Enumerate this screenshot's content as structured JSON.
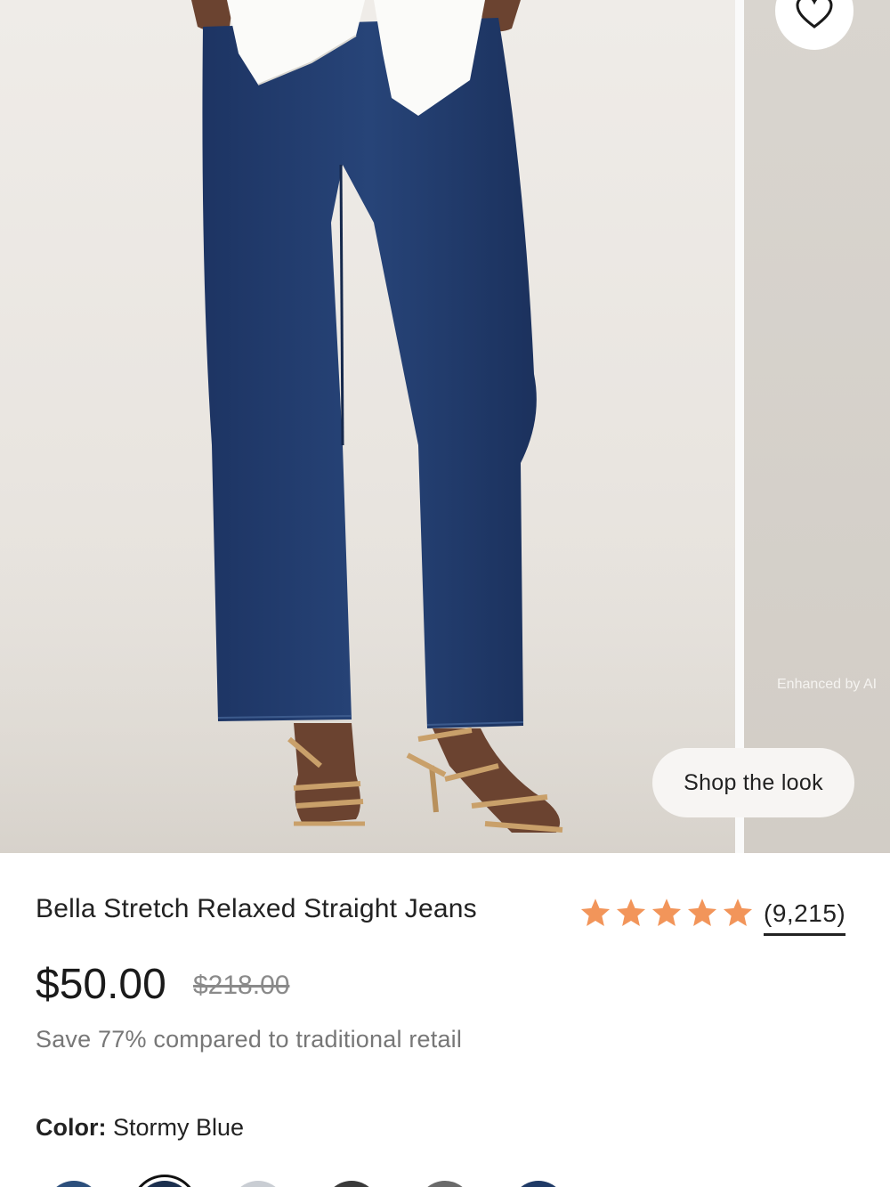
{
  "gallery": {
    "enhanced_label": "Enhanced by AI",
    "shop_look_label": "Shop the look",
    "favorite_icon": "heart-icon"
  },
  "product": {
    "title": "Bella Stretch Relaxed Straight Jeans",
    "rating_value": 5,
    "rating_max": 5,
    "review_count": "(9,215)",
    "price": "$50.00",
    "original_price": "$218.00",
    "savings_text": "Save 77% compared to traditional retail"
  },
  "color": {
    "label": "Color:",
    "selected": "Stormy Blue",
    "swatches": [
      "#2c4f7c",
      "#1b2f4e",
      "#c9cdd3",
      "#3a3a3a",
      "#6a6a6a",
      "#1f3a66"
    ],
    "selected_index": 1
  },
  "colors": {
    "star": "#f2955a",
    "text": "#222222",
    "muted": "#777777"
  }
}
